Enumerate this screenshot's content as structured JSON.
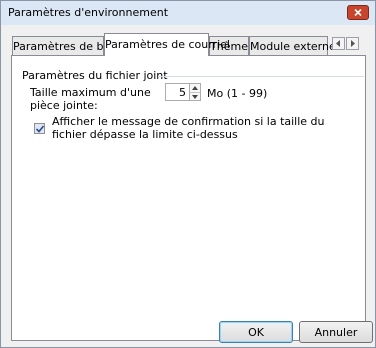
{
  "window": {
    "title": "Paramètres d'environnement"
  },
  "tabs": [
    {
      "label": "Paramètres de base"
    },
    {
      "label": "Paramètres de courriel"
    },
    {
      "label": "Thème"
    },
    {
      "label": "Module externe"
    }
  ],
  "attachment": {
    "group_label": "Paramètres du fichier joint",
    "max_size_label": "Taille maximum d'une pièce jointe:",
    "max_size_value": "5",
    "unit_label": "Mo (1 - 99)",
    "confirm_checked": true,
    "confirm_label": "Afficher le message de confirmation si la taille du fichier dépasse la limite ci-dessus"
  },
  "buttons": {
    "ok": "OK",
    "cancel": "Annuler"
  },
  "colors": {
    "title_bar": "#dbe7f5",
    "close_button": "#c8442c",
    "ok_border": "#3c7fb1"
  }
}
